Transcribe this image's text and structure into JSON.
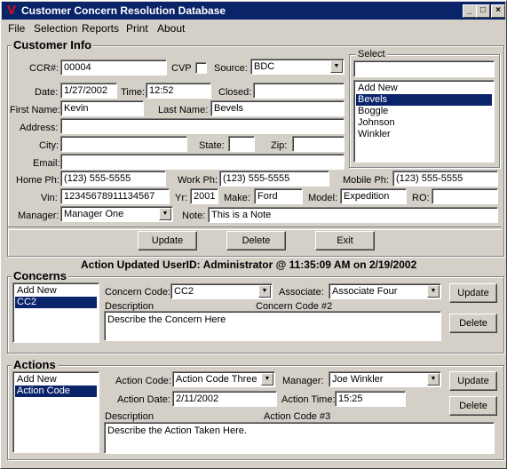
{
  "window": {
    "title": "Customer Concern Resolution Database",
    "min_label": "_",
    "max_label": "□",
    "close_label": "×"
  },
  "menu": [
    "File",
    "Selection",
    "Reports",
    "Print",
    "About"
  ],
  "customer_info": {
    "heading": "Customer Info",
    "ccr_label": "CCR#:",
    "ccr": "00004",
    "cvp_label": "CVP",
    "source_label": "Source:",
    "source": "BDC",
    "date_label": "Date:",
    "date": "1/27/2002",
    "time_label": "Time:",
    "time": "12:52",
    "closed_label": "Closed:",
    "closed": "",
    "first_name_label": "First Name:",
    "first_name": "Kevin",
    "last_name_label": "Last Name:",
    "last_name": "Bevels",
    "address_label": "Address:",
    "address": "",
    "city_label": "City:",
    "city": "",
    "state_label": "State:",
    "state": "",
    "zip_label": "Zip:",
    "zip": "",
    "email_label": "Email:",
    "email": "",
    "home_ph_label": "Home Ph:",
    "home_ph": "(123) 555-5555",
    "work_ph_label": "Work Ph:",
    "work_ph": "(123) 555-5555",
    "mobile_ph_label": "Mobile Ph:",
    "mobile_ph": "(123) 555-5555",
    "vin_label": "Vin:",
    "vin": "12345678911134567",
    "yr_label": "Yr:",
    "yr": "2001",
    "make_label": "Make:",
    "make": "Ford",
    "model_label": "Model:",
    "model": "Expedition",
    "ro_label": "RO:",
    "ro": "",
    "manager_label": "Manager:",
    "manager": "Manager One",
    "note_label": "Note:",
    "note": "This is a Note"
  },
  "select_panel": {
    "heading": "Select",
    "search": "",
    "items": [
      "Add New",
      "Bevels",
      "Boggle",
      "Johnson",
      "Winkler"
    ],
    "selected_index": 1
  },
  "buttons": {
    "update": "Update",
    "delete": "Delete",
    "exit": "Exit"
  },
  "status": "Action Updated UserID: Administrator @ 11:35:09 AM on 2/19/2002",
  "concerns": {
    "heading": "Concerns",
    "list": [
      "Add New",
      "CC2"
    ],
    "selected_index": 1,
    "code_label": "Concern Code:",
    "code": "CC2",
    "associate_label": "Associate:",
    "associate": "Associate Four",
    "description_label": "Description",
    "code_caption": "Concern Code #2",
    "description": "Describe the Concern Here",
    "update": "Update",
    "delete": "Delete"
  },
  "actions": {
    "heading": "Actions",
    "list": [
      "Add New",
      "Action Code Three"
    ],
    "selected_index": 1,
    "code_label": "Action Code:",
    "code": "Action Code Three",
    "manager_label": "Manager:",
    "manager": "Joe Winkler",
    "date_label": "Action Date:",
    "date": "2/11/2002",
    "time_label": "Action Time:",
    "time": "15:25",
    "description_label": "Description",
    "code_caption": "Action Code #3",
    "description": "Describe the Action Taken Here.",
    "update": "Update",
    "delete": "Delete"
  }
}
